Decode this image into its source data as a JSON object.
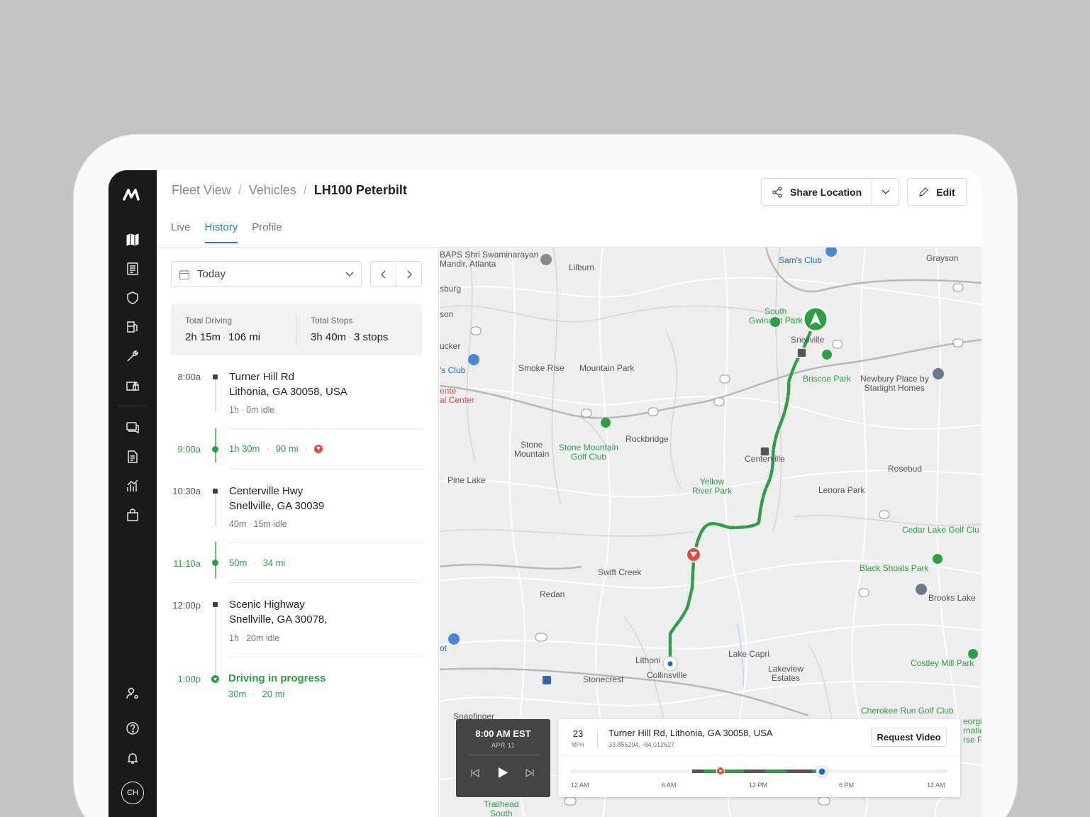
{
  "breadcrumb": {
    "items": [
      "Fleet View",
      "Vehicles"
    ],
    "current": "LH100 Peterbilt"
  },
  "header": {
    "share_label": "Share Location",
    "edit_label": "Edit"
  },
  "tabs": [
    {
      "label": "Live"
    },
    {
      "label": "History"
    },
    {
      "label": "Profile"
    }
  ],
  "active_tab": "History",
  "sidebar": {
    "avatar": "CH"
  },
  "panel": {
    "date_value": "Today",
    "summary": {
      "driving_label": "Total Driving",
      "driving_time": "2h 15m",
      "driving_distance": "106 mi",
      "stops_label": "Total Stops",
      "stops_time": "3h 40m",
      "stops_count": "3 stops"
    },
    "timeline": [
      {
        "time": "8:00a",
        "line1": "Turner Hill Rd",
        "line2": "Lithonia, GA 30058, USA",
        "meta1": "1h",
        "meta2": "0m idle"
      },
      {
        "time": "9:00a",
        "dur": "1h 30m",
        "dist": "90 mi"
      },
      {
        "time": "10:30a",
        "line1": "Centerville Hwy",
        "line2": "Snellville, GA 30039",
        "meta1": "40m",
        "meta2": "15m idle"
      },
      {
        "time": "11:10a",
        "dur": "50m",
        "dist": "34 mi"
      },
      {
        "time": "12:00p",
        "line1": "Scenic Highway",
        "line2": "Snellville, GA 30078,",
        "meta1": "1h",
        "meta2": "20m idle"
      },
      {
        "time": "1:00p",
        "status": "Driving in progress",
        "dur": "30m",
        "dist": "20 mi"
      }
    ]
  },
  "map": {
    "labels": [
      {
        "text": "Lilburn",
        "c": ""
      },
      {
        "text": "Grayson",
        "c": ""
      },
      {
        "text": "Sam's Club",
        "c": "blue"
      },
      {
        "text": "BAPS Shri Swaminarayan\nMandir, Atlanta",
        "c": ""
      },
      {
        "text": "sburg",
        "c": ""
      },
      {
        "text": "son",
        "c": ""
      },
      {
        "text": "South\nGwinnett Park",
        "c": "green"
      },
      {
        "text": "Snellville",
        "c": ""
      },
      {
        "text": "ucker",
        "c": ""
      },
      {
        "text": "'s Club",
        "c": "blue"
      },
      {
        "text": "Smoke Rise",
        "c": ""
      },
      {
        "text": "Mountain Park",
        "c": ""
      },
      {
        "text": "Briscoe Park",
        "c": "green"
      },
      {
        "text": "Newbury Place by\nStarlight Homes",
        "c": ""
      },
      {
        "text": "ente\nal Center",
        "c": "red"
      },
      {
        "text": "Rockbridge",
        "c": ""
      },
      {
        "text": "Stone\nMountain",
        "c": ""
      },
      {
        "text": "Stone Mountain\nGolf Club",
        "c": "green"
      },
      {
        "text": "Centerville",
        "c": ""
      },
      {
        "text": "Rosebud",
        "c": ""
      },
      {
        "text": "Pine Lake",
        "c": ""
      },
      {
        "text": "Yellow\nRiver Park",
        "c": "green"
      },
      {
        "text": "Lenora Park",
        "c": ""
      },
      {
        "text": "Cedar Lake Golf Clu",
        "c": "green"
      },
      {
        "text": "Black Shoals Park",
        "c": "green"
      },
      {
        "text": "Swift Creek",
        "c": ""
      },
      {
        "text": "Redan",
        "c": ""
      },
      {
        "text": "Brooks Lake",
        "c": ""
      },
      {
        "text": "Lake Capri",
        "c": ""
      },
      {
        "text": "Lakeview\nEstates",
        "c": ""
      },
      {
        "text": "Costley Mill Park",
        "c": "green"
      },
      {
        "text": "Lithoni",
        "c": ""
      },
      {
        "text": "Collinsville",
        "c": ""
      },
      {
        "text": "Stonecrest",
        "c": ""
      },
      {
        "text": "ot",
        "c": "blue"
      },
      {
        "text": "Snapfinger",
        "c": ""
      },
      {
        "text": "Cherokee Run Golf Club",
        "c": "green"
      },
      {
        "text": "eorgi\nrnatic\nrse Pa",
        "c": "green"
      },
      {
        "text": "Trailhead\nSouth",
        "c": "green"
      }
    ]
  },
  "playback": {
    "time": "8:00 AM EST",
    "date": "APR 11"
  },
  "info": {
    "speed": "23",
    "speed_unit": "MPH",
    "address": "Turner Hill Rd, Lithonia, GA 30058, USA",
    "coords": "33.856294, -84.012627",
    "request_label": "Request Video",
    "ticks": [
      "12 AM",
      "6 AM",
      "12 PM",
      "6 PM",
      "12 AM"
    ]
  },
  "colors": {
    "accent": "#1a7fd1",
    "route": "#2e9e48",
    "stop_marker": "#e8493a",
    "sidebar": "#1a1a1a"
  }
}
